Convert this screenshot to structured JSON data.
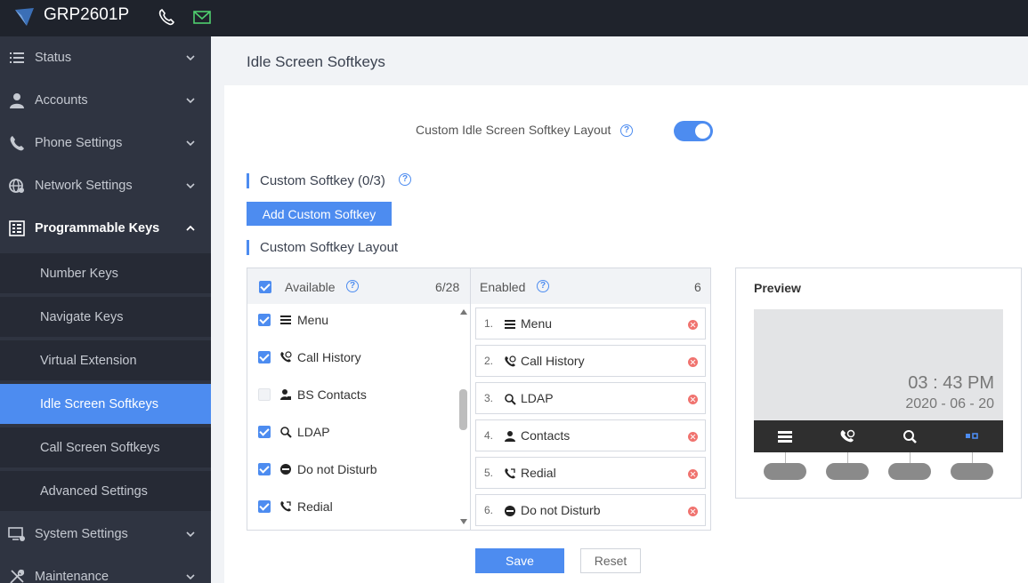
{
  "topbar": {
    "brand": "GRP2601P",
    "icons": [
      "grandstream-logo-icon",
      "phone-icon",
      "mail-icon"
    ]
  },
  "sidebar": {
    "items": [
      {
        "label": "Status",
        "icon": "list-icon"
      },
      {
        "label": "Accounts",
        "icon": "user-icon"
      },
      {
        "label": "Phone Settings",
        "icon": "phone-icon"
      },
      {
        "label": "Network Settings",
        "icon": "globe-icon"
      },
      {
        "label": "Programmable Keys",
        "icon": "keypad-icon",
        "expanded": true
      },
      {
        "label": "System Settings",
        "icon": "monitor-gear-icon"
      },
      {
        "label": "Maintenance",
        "icon": "tools-icon"
      }
    ],
    "subitems": [
      {
        "label": "Number Keys"
      },
      {
        "label": "Navigate Keys"
      },
      {
        "label": "Virtual Extension"
      },
      {
        "label": "Idle Screen Softkeys",
        "active": true
      },
      {
        "label": "Call Screen Softkeys"
      },
      {
        "label": "Advanced Settings"
      }
    ]
  },
  "page": {
    "title": "Idle Screen Softkeys",
    "toggle_label": "Custom Idle Screen Softkey Layout",
    "toggle_on": true,
    "custom_softkey_title": "Custom Softkey (0/3)",
    "add_button": "Add Custom Softkey",
    "layout_title": "Custom Softkey Layout",
    "save": "Save",
    "reset": "Reset"
  },
  "available": {
    "header": "Available",
    "count": "6/28",
    "items": [
      {
        "label": "Menu",
        "checked": true,
        "icon": "menu-icon"
      },
      {
        "label": "Call History",
        "checked": true,
        "icon": "call-history-icon"
      },
      {
        "label": "BS Contacts",
        "checked": false,
        "icon": "bs-contacts-icon"
      },
      {
        "label": "LDAP",
        "checked": true,
        "icon": "ldap-icon"
      },
      {
        "label": "Do not Disturb",
        "checked": true,
        "icon": "dnd-icon"
      },
      {
        "label": "Redial",
        "checked": true,
        "icon": "redial-icon"
      }
    ]
  },
  "enabled": {
    "header": "Enabled",
    "count": "6",
    "items": [
      {
        "num": "1.",
        "label": "Menu",
        "icon": "menu-icon"
      },
      {
        "num": "2.",
        "label": "Call History",
        "icon": "call-history-icon"
      },
      {
        "num": "3.",
        "label": "LDAP",
        "icon": "ldap-icon"
      },
      {
        "num": "4.",
        "label": "Contacts",
        "icon": "contacts-icon"
      },
      {
        "num": "5.",
        "label": "Redial",
        "icon": "redial-icon"
      },
      {
        "num": "6.",
        "label": "Do not Disturb",
        "icon": "dnd-icon"
      }
    ]
  },
  "preview": {
    "title": "Preview",
    "time": "03 : 43 PM",
    "date": "2020 - 06 - 20",
    "softkey_icons": [
      "menu-icon",
      "call-history-icon",
      "ldap-icon",
      "more-icon"
    ]
  },
  "colors": {
    "accent": "#4d8cf0",
    "topbar": "#1f232c",
    "sidebar": "#2f3441",
    "delete": "#f0736f"
  }
}
